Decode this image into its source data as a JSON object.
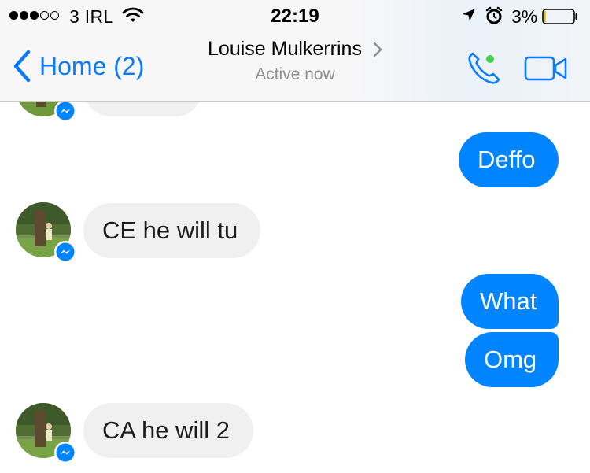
{
  "status_bar": {
    "carrier": "3 IRL",
    "time": "22:19",
    "battery_percent": "3%",
    "signal_bars_filled": 3,
    "signal_bars_total": 5,
    "battery_level": 0.03,
    "icons": [
      "signal-dots-icon",
      "wifi-icon",
      "location-arrow-icon",
      "alarm-clock-icon",
      "battery-icon"
    ]
  },
  "nav": {
    "back_label": "Home (2)",
    "contact_name": "Louise Mulkerrins",
    "status_text": "Active now",
    "icons": [
      "back-chevron-icon",
      "chevron-right-icon",
      "phone-call-icon",
      "video-camera-icon"
    ],
    "online_dot_color": "#44d14f"
  },
  "messages": [
    {
      "direction": "in",
      "text": ""
    },
    {
      "direction": "out",
      "text": "Deffo"
    },
    {
      "direction": "in",
      "text": "CE he will tu"
    },
    {
      "direction": "out",
      "text": "What"
    },
    {
      "direction": "out",
      "text": "Omg"
    },
    {
      "direction": "in",
      "text": "CA he will 2"
    }
  ],
  "colors": {
    "accent": "#0a7aff",
    "outgoing_bubble": "#0084ff",
    "incoming_bubble": "#f1f0f0",
    "messenger_badge": "#0084ff"
  }
}
